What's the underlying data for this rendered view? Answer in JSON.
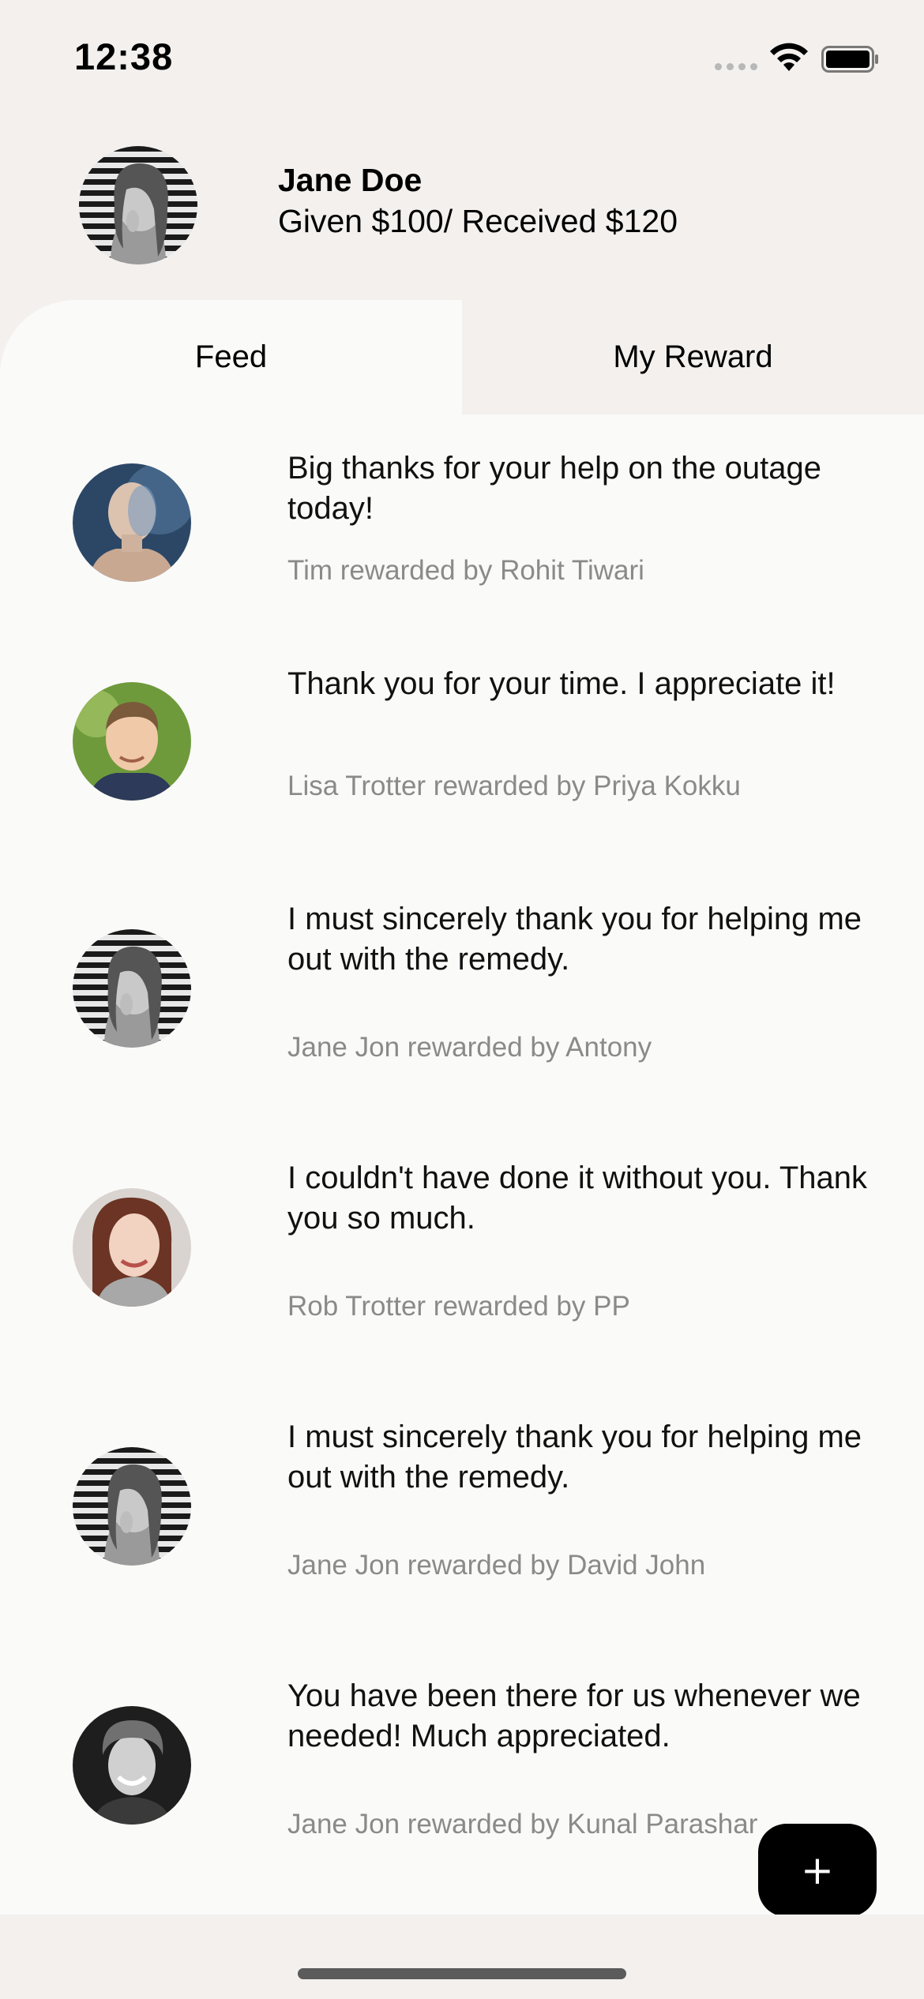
{
  "status_bar": {
    "time": "12:38",
    "icons": [
      "cellular-dots-icon",
      "wifi-icon",
      "battery-icon"
    ]
  },
  "profile": {
    "name": "Jane Doe",
    "stats": "Given $100/ Received $120",
    "avatar": "woman-portrait-avatar"
  },
  "tabs": [
    {
      "label": "Feed",
      "active": true
    },
    {
      "label": "My Reward",
      "active": false
    }
  ],
  "feed": [
    {
      "message": "Big thanks for your help on the outage today!",
      "meta": "Tim rewarded by Rohit Tiwari",
      "avatar": "bald-man-avatar"
    },
    {
      "message": "Thank you for your time. I appreciate it!",
      "meta": "Lisa Trotter rewarded by Priya Kokku",
      "avatar": "boy-avatar"
    },
    {
      "message": "I must sincerely thank you for helping me out with the remedy.",
      "meta": "Jane Jon rewarded by Antony",
      "avatar": "woman-portrait-avatar"
    },
    {
      "message": "I couldn't have done it without you. Thank you so much.",
      "meta": "Rob Trotter rewarded by PP",
      "avatar": "smiling-woman-avatar"
    },
    {
      "message": "I must sincerely thank you for helping me out with the remedy.",
      "meta": "Jane Jon rewarded by David John",
      "avatar": "woman-portrait-avatar"
    },
    {
      "message": "You have been there for us whenever we needed! Much appreciated.",
      "meta": "Jane Jon rewarded by Kunal Parashar",
      "avatar": "smiling-man-avatar"
    }
  ],
  "fab": {
    "icon": "plus-icon",
    "glyph": "+"
  },
  "colors": {
    "background": "#f3f0ee",
    "feed_background": "#fafaf9",
    "meta_text": "#8a8a8a",
    "fab": "#000000"
  }
}
